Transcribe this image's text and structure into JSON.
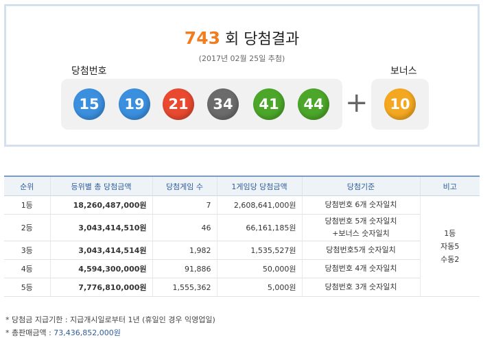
{
  "result": {
    "round": "743",
    "round_suffix": "회 당첨결과",
    "date": "(2017년 02월 25일 추첨)",
    "winning_label": "당첨번호",
    "bonus_label": "보너스",
    "numbers": [
      "15",
      "19",
      "21",
      "34",
      "41",
      "44"
    ],
    "ball_colors": [
      "#3b8fdf",
      "#3b8fdf",
      "#e8492f",
      "#6b6b6b",
      "#4ba62a",
      "#4ba62a"
    ],
    "bonus": "10",
    "bonus_color": "#f4a821",
    "plus": "+"
  },
  "table": {
    "headers": [
      "순위",
      "등위별 총 당첨금액",
      "당첨게임 수",
      "1게임당 당첨금액",
      "당첨기준",
      "비고"
    ],
    "rows": [
      {
        "rank": "1등",
        "total": "18,260,487,000원",
        "games": "7",
        "per_game": "2,608,641,000원",
        "criteria": [
          "당첨번호 6개 숫자일치"
        ]
      },
      {
        "rank": "2등",
        "total": "3,043,414,510원",
        "games": "46",
        "per_game": "66,161,185원",
        "criteria": [
          "당첨번호 5개 숫자일치",
          "+보너스 숫자일치"
        ]
      },
      {
        "rank": "3등",
        "total": "3,043,414,514원",
        "games": "1,982",
        "per_game": "1,535,527원",
        "criteria": [
          "당첨번호5개 숫자일치"
        ]
      },
      {
        "rank": "4등",
        "total": "4,594,300,000원",
        "games": "91,886",
        "per_game": "50,000원",
        "criteria": [
          "당첨번호 4개 숫자일치"
        ]
      },
      {
        "rank": "5등",
        "total": "7,776,810,000원",
        "games": "1,555,362",
        "per_game": "5,000원",
        "criteria": [
          "당첨번호 3개 숫자일치"
        ]
      }
    ],
    "note": [
      "1등",
      "자동5",
      "수동2"
    ]
  },
  "footer": {
    "deadline": "* 당첨금 지급기한 : 지급개시일로부터 1년 (휴일인 경우 익영업일)",
    "sales_label": "* 총판매금액 : ",
    "sales_value": "73,436,852,000원"
  }
}
